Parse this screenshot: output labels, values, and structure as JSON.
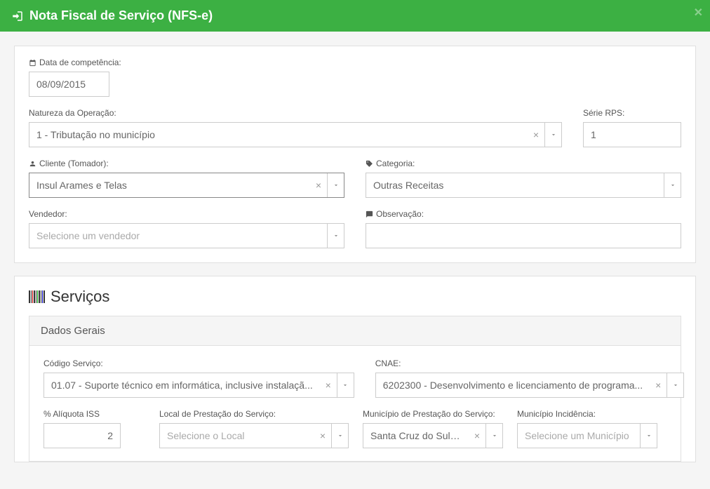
{
  "header": {
    "title": "Nota Fiscal de Serviço (NFS-e)"
  },
  "form": {
    "data_competencia": {
      "label": "Data de competência:",
      "value": "08/09/2015"
    },
    "natureza_operacao": {
      "label": "Natureza da Operação:",
      "value": "1 - Tributação no município"
    },
    "serie_rps": {
      "label": "Série RPS:",
      "value": "1"
    },
    "cliente": {
      "label": "Cliente (Tomador):",
      "value": "Insul Arames e Telas"
    },
    "categoria": {
      "label": "Categoria:",
      "value": "Outras Receitas"
    },
    "vendedor": {
      "label": "Vendedor:",
      "placeholder": "Selecione um vendedor"
    },
    "observacao": {
      "label": "Observação:"
    }
  },
  "servicos": {
    "title": "Serviços",
    "dados_gerais": {
      "title": "Dados Gerais",
      "codigo_servico": {
        "label": "Código Serviço:",
        "value": "01.07 - Suporte técnico em informática, inclusive instalaçã..."
      },
      "cnae": {
        "label": "CNAE:",
        "value": "6202300 - Desenvolvimento e licenciamento de programa..."
      },
      "aliquota_iss": {
        "label": "% Alíquota ISS",
        "value": "2"
      },
      "local_prestacao": {
        "label": "Local de Prestação do Serviço:",
        "placeholder": "Selecione o Local"
      },
      "municipio_prestacao": {
        "label": "Município de Prestação do Serviço:",
        "value": "Santa Cruz do Sul (RS)"
      },
      "municipio_incidencia": {
        "label": "Município Incidência:",
        "placeholder": "Selecione um Município"
      }
    }
  }
}
